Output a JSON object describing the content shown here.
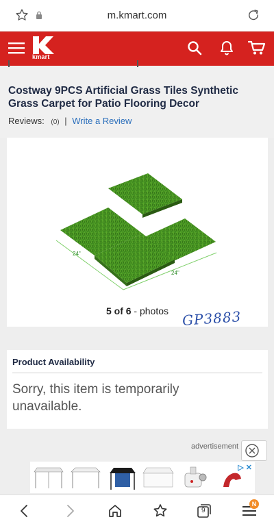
{
  "browser": {
    "url": "m.kmart.com"
  },
  "header": {
    "logo_text": "kmart",
    "brand_color": "#d5221f"
  },
  "product": {
    "title": "Costway 9PCS Artificial Grass Tiles Synthetic Grass Carpet for Patio Flooring Decor",
    "reviews_label": "Reviews:",
    "reviews_count": "(0)",
    "separator": "|",
    "write_review": "Write a Review"
  },
  "gallery": {
    "dimension_left": "24\"",
    "dimension_right": "24\"",
    "current": "5 of 6",
    "suffix": " - photos",
    "handwritten_note": "GP3883"
  },
  "availability": {
    "title": "Product Availability",
    "message": "Sorry, this item is temporarily unavailable."
  },
  "ad": {
    "label": "advertisement"
  },
  "bottom_nav": {
    "tab_count": "9",
    "notification_badge": "N"
  }
}
